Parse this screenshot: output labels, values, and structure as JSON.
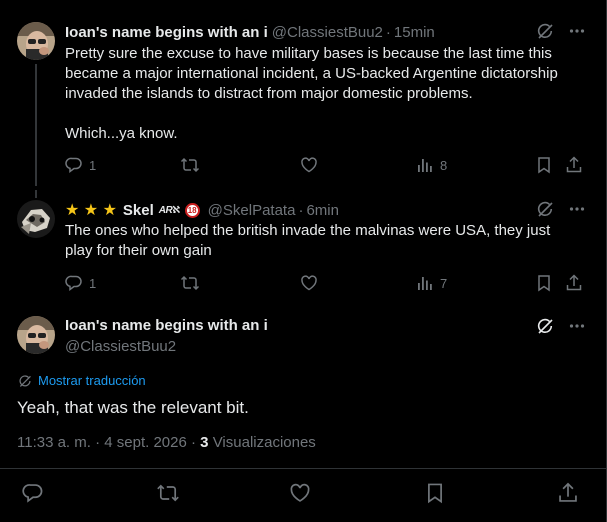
{
  "replies": [
    {
      "display_name": "Ioan's name begins with an i",
      "handle": "@ClassiestBuu2",
      "time": "15min",
      "text_lines": [
        "Pretty sure the excuse to have military bases is because the last time this",
        "became a major international incident, a US-backed Argentine dictatorship",
        "invaded the islands to distract from major domestic problems."
      ],
      "text_last": "Which...ya know.",
      "reply_count": "1",
      "repost_count": "",
      "like_count": "",
      "view_count": "8"
    },
    {
      "display_name": "Skel",
      "name_stars": "★ ★ ★",
      "name_badge": "ARℵ",
      "age_badge": "18",
      "handle": "@SkelPatata",
      "time": "6min",
      "text_lines": [
        "The ones who helped the british invade the malvinas were USA, they just",
        "play for their own gain"
      ],
      "reply_count": "1",
      "repost_count": "",
      "like_count": "",
      "view_count": "7"
    }
  ],
  "main": {
    "display_name": "Ioan's name begins with an i",
    "handle": "@ClassiestBuu2",
    "translate_label": "Mostrar traducción",
    "text": "Yeah, that was the relevant bit.",
    "timestamp": "11:33 a. m. · 4 sept. 2026 · ",
    "view_count": "3",
    "views_label": "Visualizaciones"
  },
  "colors": {
    "background": "#000000",
    "text": "#e7e9ea",
    "muted": "#71767b",
    "link": "#1d9bf0",
    "star": "#f5c518"
  },
  "icons": [
    "reply-icon",
    "repost-icon",
    "like-icon",
    "views-icon",
    "bookmark-icon",
    "share-icon",
    "grok-icon",
    "more-icon",
    "translate-icon"
  ]
}
